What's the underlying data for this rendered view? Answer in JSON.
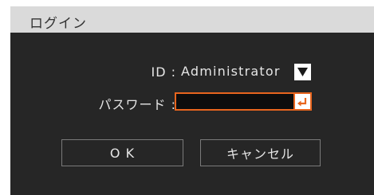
{
  "dialog": {
    "title": "ログイン"
  },
  "form": {
    "id_label": "ID :",
    "id_value": "Administrator",
    "password_label": "パスワード :",
    "password_value": ""
  },
  "buttons": {
    "ok_label": "O K",
    "cancel_label": "キャンセル"
  },
  "icons": {
    "dropdown": "chevron-down-icon",
    "enter": "enter-key-icon"
  },
  "colors": {
    "accent": "#e8651e",
    "background": "#262626",
    "titlebar": "#dadada"
  }
}
